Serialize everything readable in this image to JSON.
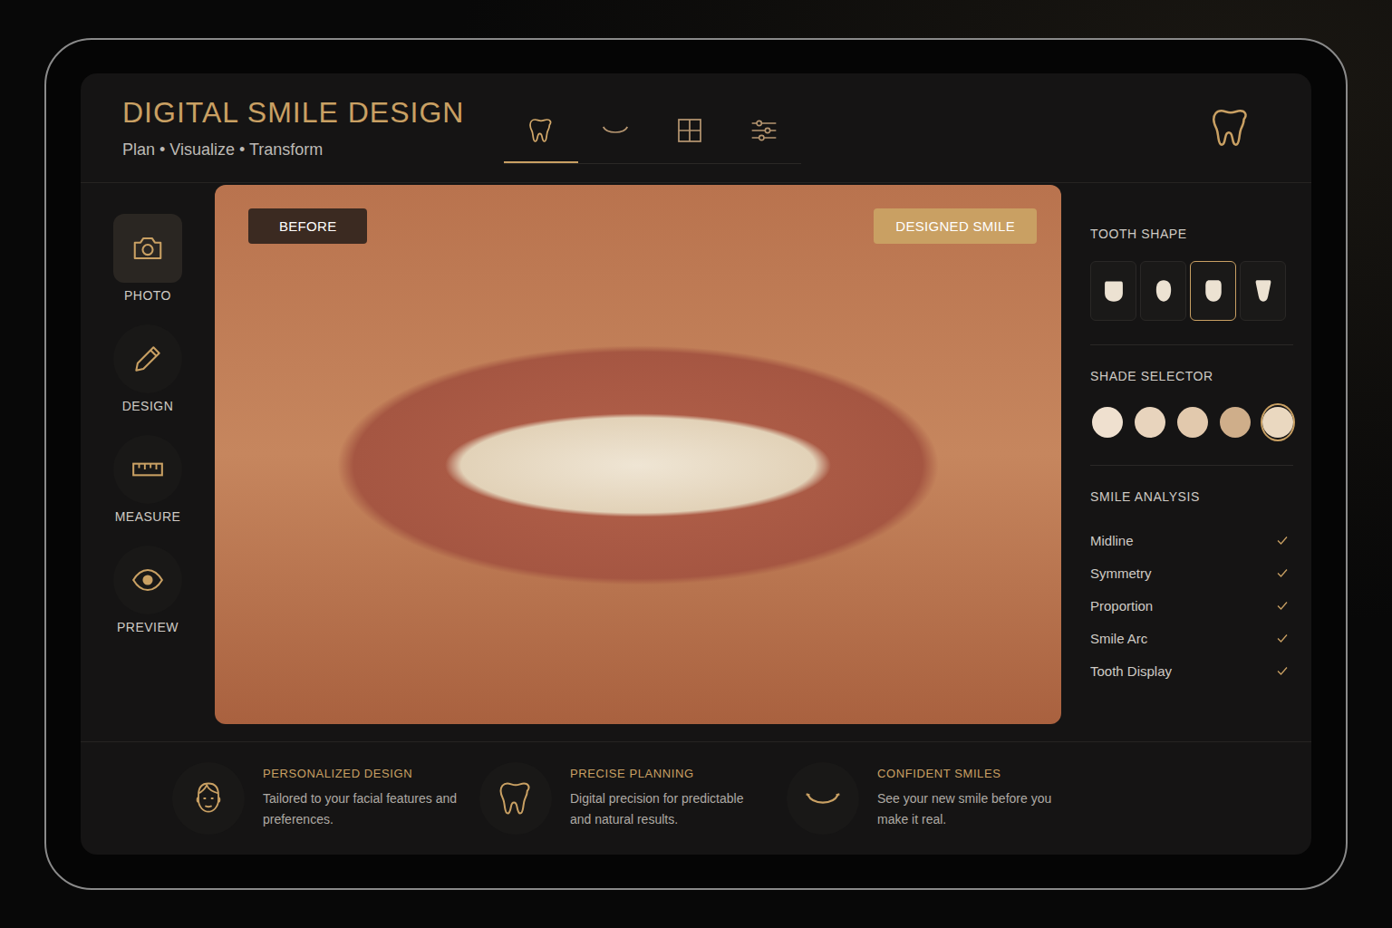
{
  "app": {
    "title": "DIGITAL SMILE DESIGN",
    "subtitle": "Plan • Visualize • Transform"
  },
  "tabs": [
    {
      "kind": "tooth",
      "selected": true
    },
    {
      "kind": "smile",
      "selected": false
    },
    {
      "kind": "grid",
      "selected": false
    },
    {
      "kind": "sliders",
      "selected": false
    }
  ],
  "sidebar": {
    "items": [
      {
        "label": "PHOTO",
        "kind": "camera",
        "selected": true
      },
      {
        "label": "DESIGN",
        "kind": "pencil",
        "selected": false
      },
      {
        "label": "MEASURE",
        "kind": "ruler",
        "selected": false
      },
      {
        "label": "PREVIEW",
        "kind": "eye",
        "selected": false
      }
    ]
  },
  "canvas": {
    "before_label": "BEFORE",
    "after_label": "DESIGNED SMILE"
  },
  "tooth_shape": {
    "title": "TOOTH SHAPE",
    "options": [
      {
        "kind": "square",
        "selected": false
      },
      {
        "kind": "oval",
        "selected": false
      },
      {
        "kind": "rounded",
        "selected": true
      },
      {
        "kind": "tapered",
        "selected": false
      }
    ]
  },
  "shade_selector": {
    "title": "SHADE SELECTOR",
    "shades": [
      {
        "color": "#efe0cf",
        "selected": false
      },
      {
        "color": "#e8d4bd",
        "selected": false
      },
      {
        "color": "#e2c9ad",
        "selected": false
      },
      {
        "color": "#cfae8a",
        "selected": false
      },
      {
        "color": "#ead8c0",
        "selected": true
      }
    ]
  },
  "smile_analysis": {
    "title": "SMILE ANALYSIS",
    "items": [
      {
        "label": "Midline",
        "checked": true
      },
      {
        "label": "Symmetry",
        "checked": true
      },
      {
        "label": "Proportion",
        "checked": true
      },
      {
        "label": "Smile Arc",
        "checked": true
      },
      {
        "label": "Tooth Display",
        "checked": true
      }
    ]
  },
  "features": [
    {
      "kind": "face",
      "title": "PERSONALIZED DESIGN",
      "text": "Tailored to your facial features and preferences."
    },
    {
      "kind": "tooth",
      "title": "PRECISE PLANNING",
      "text": "Digital precision for predictable and natural results."
    },
    {
      "kind": "smile",
      "title": "CONFIDENT SMILES",
      "text": "See your new smile before you make it real."
    }
  ]
}
